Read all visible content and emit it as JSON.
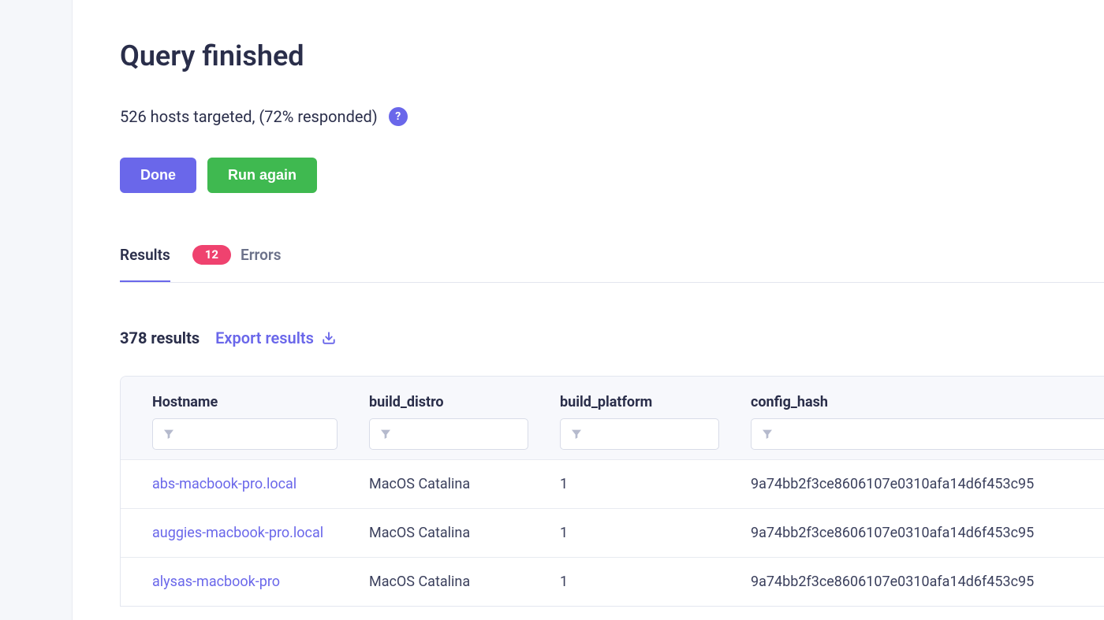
{
  "page": {
    "title": "Query finished",
    "summary": "526 hosts targeted, (72% responded)"
  },
  "buttons": {
    "done": "Done",
    "run_again": "Run again"
  },
  "tabs": {
    "results_label": "Results",
    "errors_label": "Errors",
    "errors_count": "12"
  },
  "results": {
    "count_label": "378 results",
    "export_label": "Export results"
  },
  "table": {
    "columns": [
      "Hostname",
      "build_distro",
      "build_platform",
      "config_hash"
    ],
    "rows": [
      {
        "hostname": "abs-macbook-pro.local",
        "build_distro": "MacOS Catalina",
        "build_platform": "1",
        "config_hash": "9a74bb2f3ce8606107e0310afa14d6f453c95"
      },
      {
        "hostname": "auggies-macbook-pro.local",
        "build_distro": "MacOS Catalina",
        "build_platform": "1",
        "config_hash": "9a74bb2f3ce8606107e0310afa14d6f453c95"
      },
      {
        "hostname": "alysas-macbook-pro",
        "build_distro": "MacOS Catalina",
        "build_platform": "1",
        "config_hash": "9a74bb2f3ce8606107e0310afa14d6f453c95"
      }
    ]
  }
}
